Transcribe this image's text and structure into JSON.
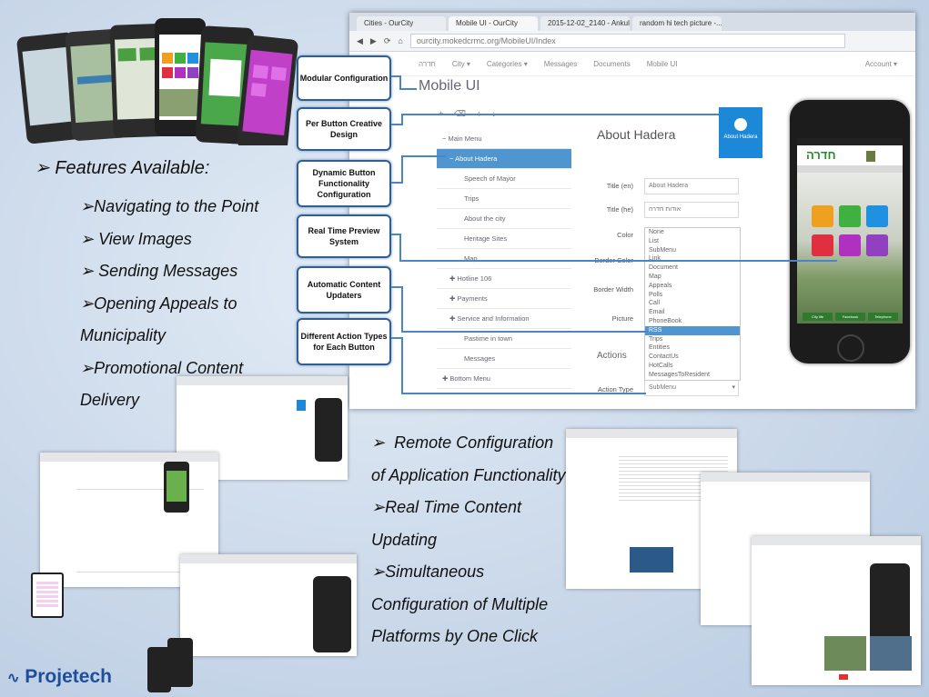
{
  "features": {
    "title": "Features Available:",
    "items": [
      "Navigating to the Point",
      "View Images",
      "Sending Messages",
      "Opening Appeals to Municipality",
      "Promotional Content Delivery"
    ]
  },
  "features2": {
    "items": [
      "Remote Configuration of Application Functionality",
      "Real Time Content Updating",
      "Simultaneous Configuration of Multiple Platforms by One Click"
    ]
  },
  "callouts": [
    "Modular Configuration",
    "Per Button Creative Design",
    "Dynamic Button Functionality Configuration",
    "Real Time Preview System",
    "Automatic Content Updaters",
    "Different Action Types for Each Button"
  ],
  "browser": {
    "tabs": [
      "Cities - OurCity",
      "Mobile UI - OurCity",
      "2015-12-02_2140 - Ankul...",
      "random hi tech picture -..."
    ],
    "url": "ourcity.mokedcrmc.org/MobileUI/Index",
    "nav": [
      "חדרה",
      "City",
      "Categories",
      "Messages",
      "Documents",
      "Mobile UI"
    ],
    "account": "Account",
    "page_title": "Mobile UI",
    "tree": [
      "Main Menu",
      "About Hadera",
      "Speech of Mayor",
      "Trips",
      "About the city",
      "Heritage Sites",
      "Map",
      "Hotline 106",
      "Payments",
      "Service and Information",
      "Pastime in town",
      "Messages",
      "Bottom Menu"
    ],
    "about_title": "About Hadera",
    "preview_button": "About Hadera",
    "form": {
      "title_en_label": "Title (en)",
      "title_en_value": "About Hadera",
      "title_he_label": "Title (he)",
      "title_he_value": "אודות חדרה",
      "color_label": "Color",
      "border_color_label": "Border Color",
      "border_width_label": "Border Width",
      "picture_label": "Picture",
      "actions_label": "Actions",
      "action_type_label": "Action Type",
      "action_type_value": "SubMenu"
    },
    "action_types": [
      "None",
      "List",
      "SubMenu",
      "Link",
      "Document",
      "Map",
      "Appeals",
      "Polls",
      "Call",
      "Email",
      "PhoneBook",
      "RSS",
      "Trips",
      "Entities",
      "ContactUs",
      "HotCalls",
      "MessagesToResident"
    ],
    "selected_action": "RSS"
  },
  "phone": {
    "city": "חדרה",
    "bottom_buttons": [
      "City life",
      "Facebook",
      "Telephone"
    ]
  },
  "logo": "Projetech",
  "colors": {
    "accent": "#4f95d0",
    "callout_border": "#2f5f90",
    "phone_btns": [
      "#f0a020",
      "#40b040",
      "#2090e0",
      "#e03040",
      "#b030c0",
      "#9040c0"
    ]
  }
}
